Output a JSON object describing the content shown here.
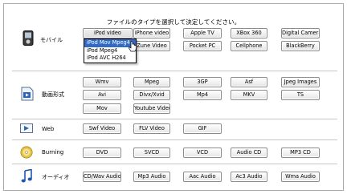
{
  "header": {
    "instruction": "ファイルのタイプを選択して決定してください。"
  },
  "categories": {
    "mobile": {
      "label": "モバイル",
      "buttons": [
        "iPod video",
        "iPhone video",
        "Apple TV",
        "XBox 360",
        "Digital Camera",
        "",
        "Zune Video",
        "Pocket PC",
        "Cellphone",
        "BlackBerry"
      ]
    },
    "video": {
      "label": "動画形式",
      "buttons": [
        "Wmv",
        "Mpeg",
        "3GP",
        "Asf",
        "Jpeg Images",
        "Avi",
        "Divx/Xvid",
        "Mp4",
        "MKV",
        "TS",
        "Mov",
        "Youtube Video"
      ]
    },
    "web": {
      "label": "Web",
      "buttons": [
        "Swf Video",
        "FLV Video",
        "GIF"
      ]
    },
    "burning": {
      "label": "Burning",
      "buttons": [
        "DVD",
        "SVCD",
        "VCD",
        "Audio CD",
        "MP3 CD"
      ]
    },
    "audio": {
      "label": "オーディオ",
      "buttons": [
        "CD/Wav Audio",
        "Mp3 Audio",
        "Aac Audio",
        "Ac3 Audio",
        "Wma Audio"
      ]
    }
  },
  "ipod_dropdown": {
    "items": [
      "iPod Mov Mpeg4",
      "iPod Mpeg4",
      "iPod AVC H264"
    ],
    "selected_index": 0
  },
  "icons": {
    "mobile": "mobile-phone-icon",
    "video": "video-file-icon",
    "web": "web-video-icon",
    "burning": "cd-disc-icon",
    "audio": "music-note-icon"
  },
  "colors": {
    "selection": "#316ac5"
  }
}
